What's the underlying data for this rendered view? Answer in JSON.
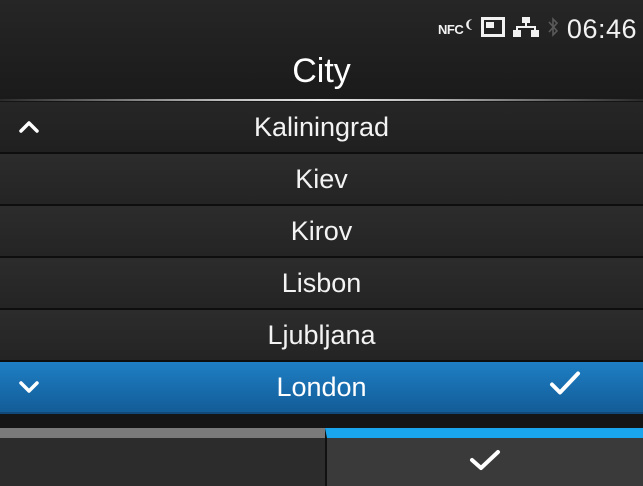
{
  "status": {
    "nfc_label": "NFC",
    "time": "06:46",
    "icons": [
      "nfc-icon",
      "card-slot-icon",
      "network-icon",
      "bluetooth-icon"
    ]
  },
  "header": {
    "title": "City"
  },
  "list": {
    "items": [
      {
        "label": "Kaliningrad"
      },
      {
        "label": "Kiev"
      },
      {
        "label": "Kirov"
      },
      {
        "label": "Lisbon"
      },
      {
        "label": "Ljubljana"
      },
      {
        "label": "London",
        "selected": true
      }
    ]
  },
  "colors": {
    "selection": "#1a72b5",
    "accent_line": "#19a6ee"
  },
  "softkeys": {
    "left_icon": "none",
    "right_icon": "check-icon"
  }
}
